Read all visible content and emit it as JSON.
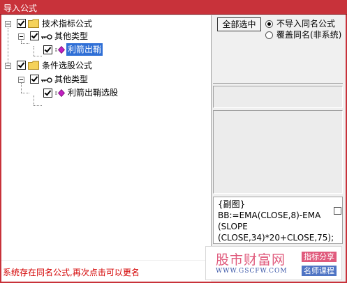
{
  "window": {
    "title": "导入公式"
  },
  "tree": {
    "nodes": [
      {
        "label": "技术指标公式",
        "checked": true
      },
      {
        "label": "其他类型",
        "checked": true
      },
      {
        "label": "利箭出鞘",
        "checked": true,
        "selected": true
      },
      {
        "label": "条件选股公式",
        "checked": true
      },
      {
        "label": "其他类型",
        "checked": true
      },
      {
        "label": "利箭出鞘选股",
        "checked": true
      }
    ]
  },
  "options": {
    "select_all_label": "全部选中",
    "radio_skip_label": "不导入同名公式",
    "radio_overwrite_label": "覆盖同名(非系统)",
    "selected": "skip"
  },
  "formula": {
    "lines": [
      "{副图}",
      "BB:=EMA(CLOSE,8)-EMA",
      "(SLOPE",
      "(CLOSE,34)*20+CLOSE,75);"
    ]
  },
  "status": {
    "message": "系统存在同名公式,再次点击可以更名",
    "color": "#d40000"
  },
  "watermark": {
    "name": "股市财富网",
    "url": "WWW.GSCFW.COM",
    "badge1": "指标分享",
    "badge2": "名师课程"
  },
  "colors": {
    "titlebar": "#c8323a",
    "selection": "#2f6fd6"
  }
}
